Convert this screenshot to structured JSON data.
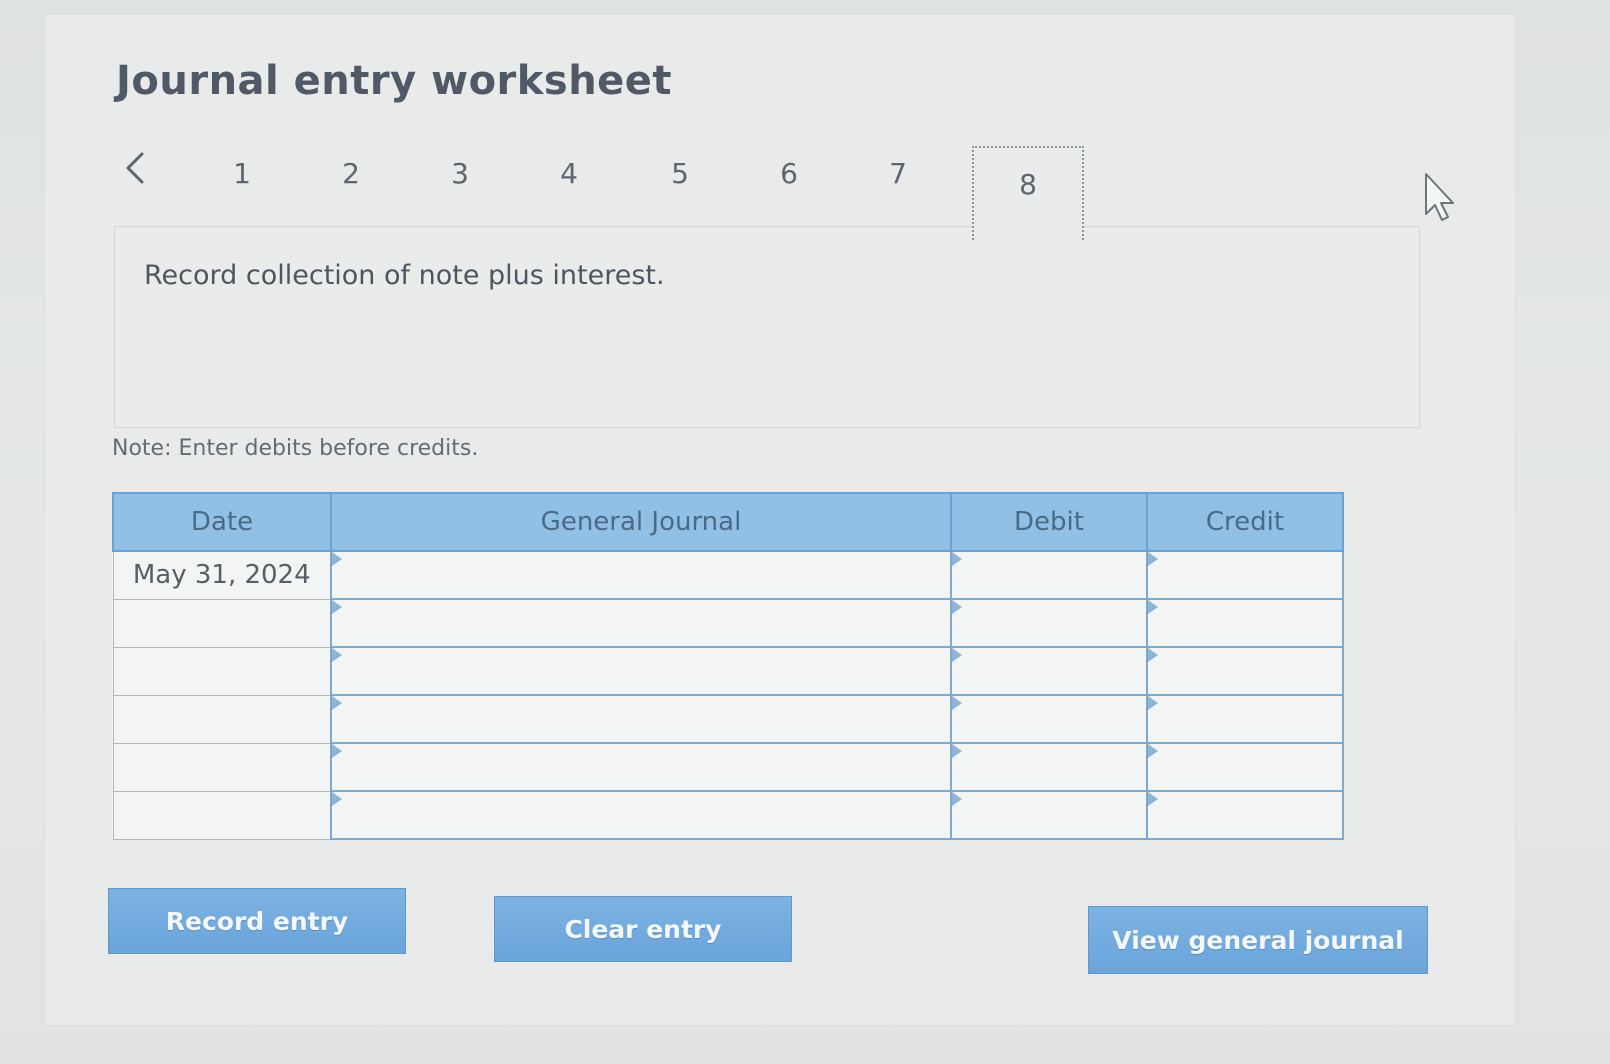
{
  "worksheet": {
    "title": "Journal entry worksheet",
    "nav": {
      "prev_icon": "chevron-left-icon",
      "steps": [
        "1",
        "2",
        "3",
        "4",
        "5",
        "6",
        "7",
        "8"
      ],
      "active_step": "8"
    },
    "instruction": "Record collection of note plus interest.",
    "note": "Note: Enter debits before credits."
  },
  "journal_table": {
    "headers": {
      "date": "Date",
      "general_journal": "General Journal",
      "debit": "Debit",
      "credit": "Credit"
    },
    "rows": [
      {
        "date": "May 31, 2024",
        "account": "",
        "debit": "",
        "credit": ""
      },
      {
        "date": "",
        "account": "",
        "debit": "",
        "credit": ""
      },
      {
        "date": "",
        "account": "",
        "debit": "",
        "credit": ""
      },
      {
        "date": "",
        "account": "",
        "debit": "",
        "credit": ""
      },
      {
        "date": "",
        "account": "",
        "debit": "",
        "credit": ""
      },
      {
        "date": "",
        "account": "",
        "debit": "",
        "credit": ""
      }
    ]
  },
  "buttons": {
    "record_entry": "Record entry",
    "clear_entry": "Clear entry",
    "view_general_journal": "View general journal"
  },
  "colors": {
    "header_bg": "#90c0e6",
    "header_text": "#4a6b88",
    "button_bg": "#6aa4da",
    "title_text": "#505a66"
  }
}
